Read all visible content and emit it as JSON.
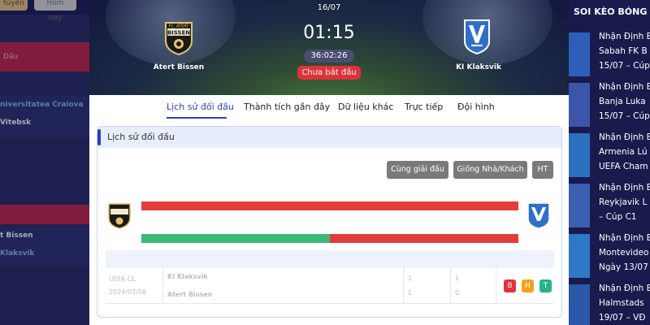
{
  "left_sidebar": {
    "pills": [
      "tuyến",
      "Hôm nay"
    ],
    "items": [
      "Đấu",
      "niversitatea Craiova",
      "Vitebsk",
      "t Bissen",
      "Klaksvik"
    ]
  },
  "match": {
    "date": "16/07",
    "kickoff": "01:15",
    "countdown": "36:02:26",
    "status": "Chưa bắt đầu",
    "home": {
      "name": "Atert Bissen",
      "crest_text": [
        "FC. ATERT",
        "BISSEN"
      ],
      "colors": [
        "#1a1a1a",
        "#e2c26b"
      ]
    },
    "away": {
      "name": "KI Klaksvik",
      "colors": [
        "#2f6fc7",
        "#ffffff"
      ]
    }
  },
  "tabs": [
    {
      "label": "Lịch sử đối đầu"
    },
    {
      "label": "Thành tích gần đây"
    },
    {
      "label": "Dữ liệu khác"
    },
    {
      "label": "Trực tiếp"
    },
    {
      "label": "Đội hình"
    }
  ],
  "h2h": {
    "title": "Lịch sử đối đầu",
    "filters": [
      "Cùng giải đấu",
      "Giống Nhà/Khách",
      "HT"
    ],
    "bar2_home_share": 0.5,
    "row": {
      "league": "UEFA CL",
      "date": "2024/07/08",
      "team1": "KI Klaksvik",
      "team2": "Atert Bissen",
      "score1": "2",
      "score2": "1",
      "ht1": "1",
      "ht2": "0"
    },
    "form": [
      "B",
      "H",
      "T"
    ]
  },
  "right_sidebar": {
    "heading": "SOI KÈO BÓNG",
    "news": [
      {
        "lines": [
          "Nhận Định B",
          "Sabah FK B",
          "15/07 – Cúp"
        ]
      },
      {
        "lines": [
          "Nhận Định B",
          "Banja Luka",
          "15/07 – Cúp"
        ]
      },
      {
        "lines": [
          "Nhận Định B",
          "Armenia Lú",
          "UEFA Cham"
        ]
      },
      {
        "lines": [
          "Nhận Định B",
          "Reykjavik L",
          "– Cúp C1"
        ]
      },
      {
        "lines": [
          "Nhận Định B",
          "Montevideo",
          "Ngày 13/07"
        ]
      },
      {
        "lines": [
          "Nhận Định B",
          "Halmstads",
          "19/07 – VĐ"
        ]
      }
    ]
  },
  "colors": {
    "accent": "#2c3fbf",
    "bar_red": "#e43b3b",
    "bar_green": "#3db878",
    "status_red": "#e0303a"
  }
}
